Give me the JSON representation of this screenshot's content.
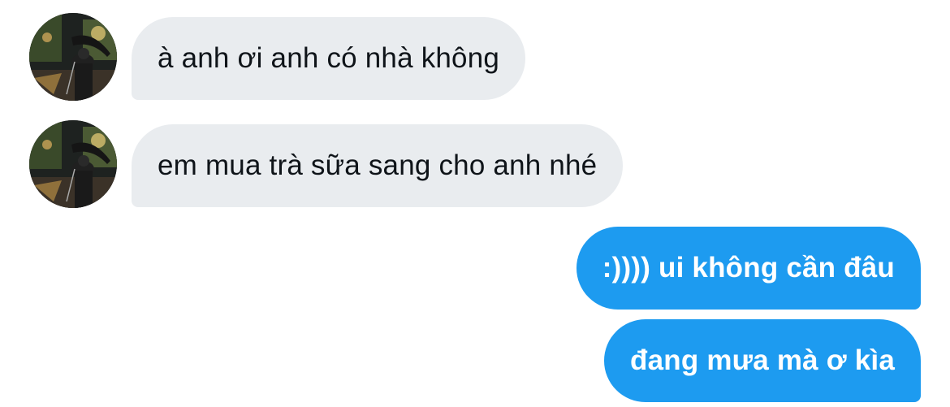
{
  "conversation": {
    "messages": [
      {
        "direction": "incoming",
        "text": "à anh ơi anh có nhà không",
        "avatar": "user-avatar-photo"
      },
      {
        "direction": "incoming",
        "text": "em mua trà sữa sang cho anh nhé",
        "avatar": "user-avatar-photo"
      },
      {
        "direction": "outgoing",
        "text": ":)))) ui không cần đâu"
      },
      {
        "direction": "outgoing",
        "text": "đang mưa mà ơ kìa"
      }
    ]
  },
  "colors": {
    "incoming_bubble": "#e9ecef",
    "incoming_text": "#0f1419",
    "outgoing_bubble": "#1d9bf0",
    "outgoing_text": "#ffffff",
    "background": "#ffffff"
  }
}
